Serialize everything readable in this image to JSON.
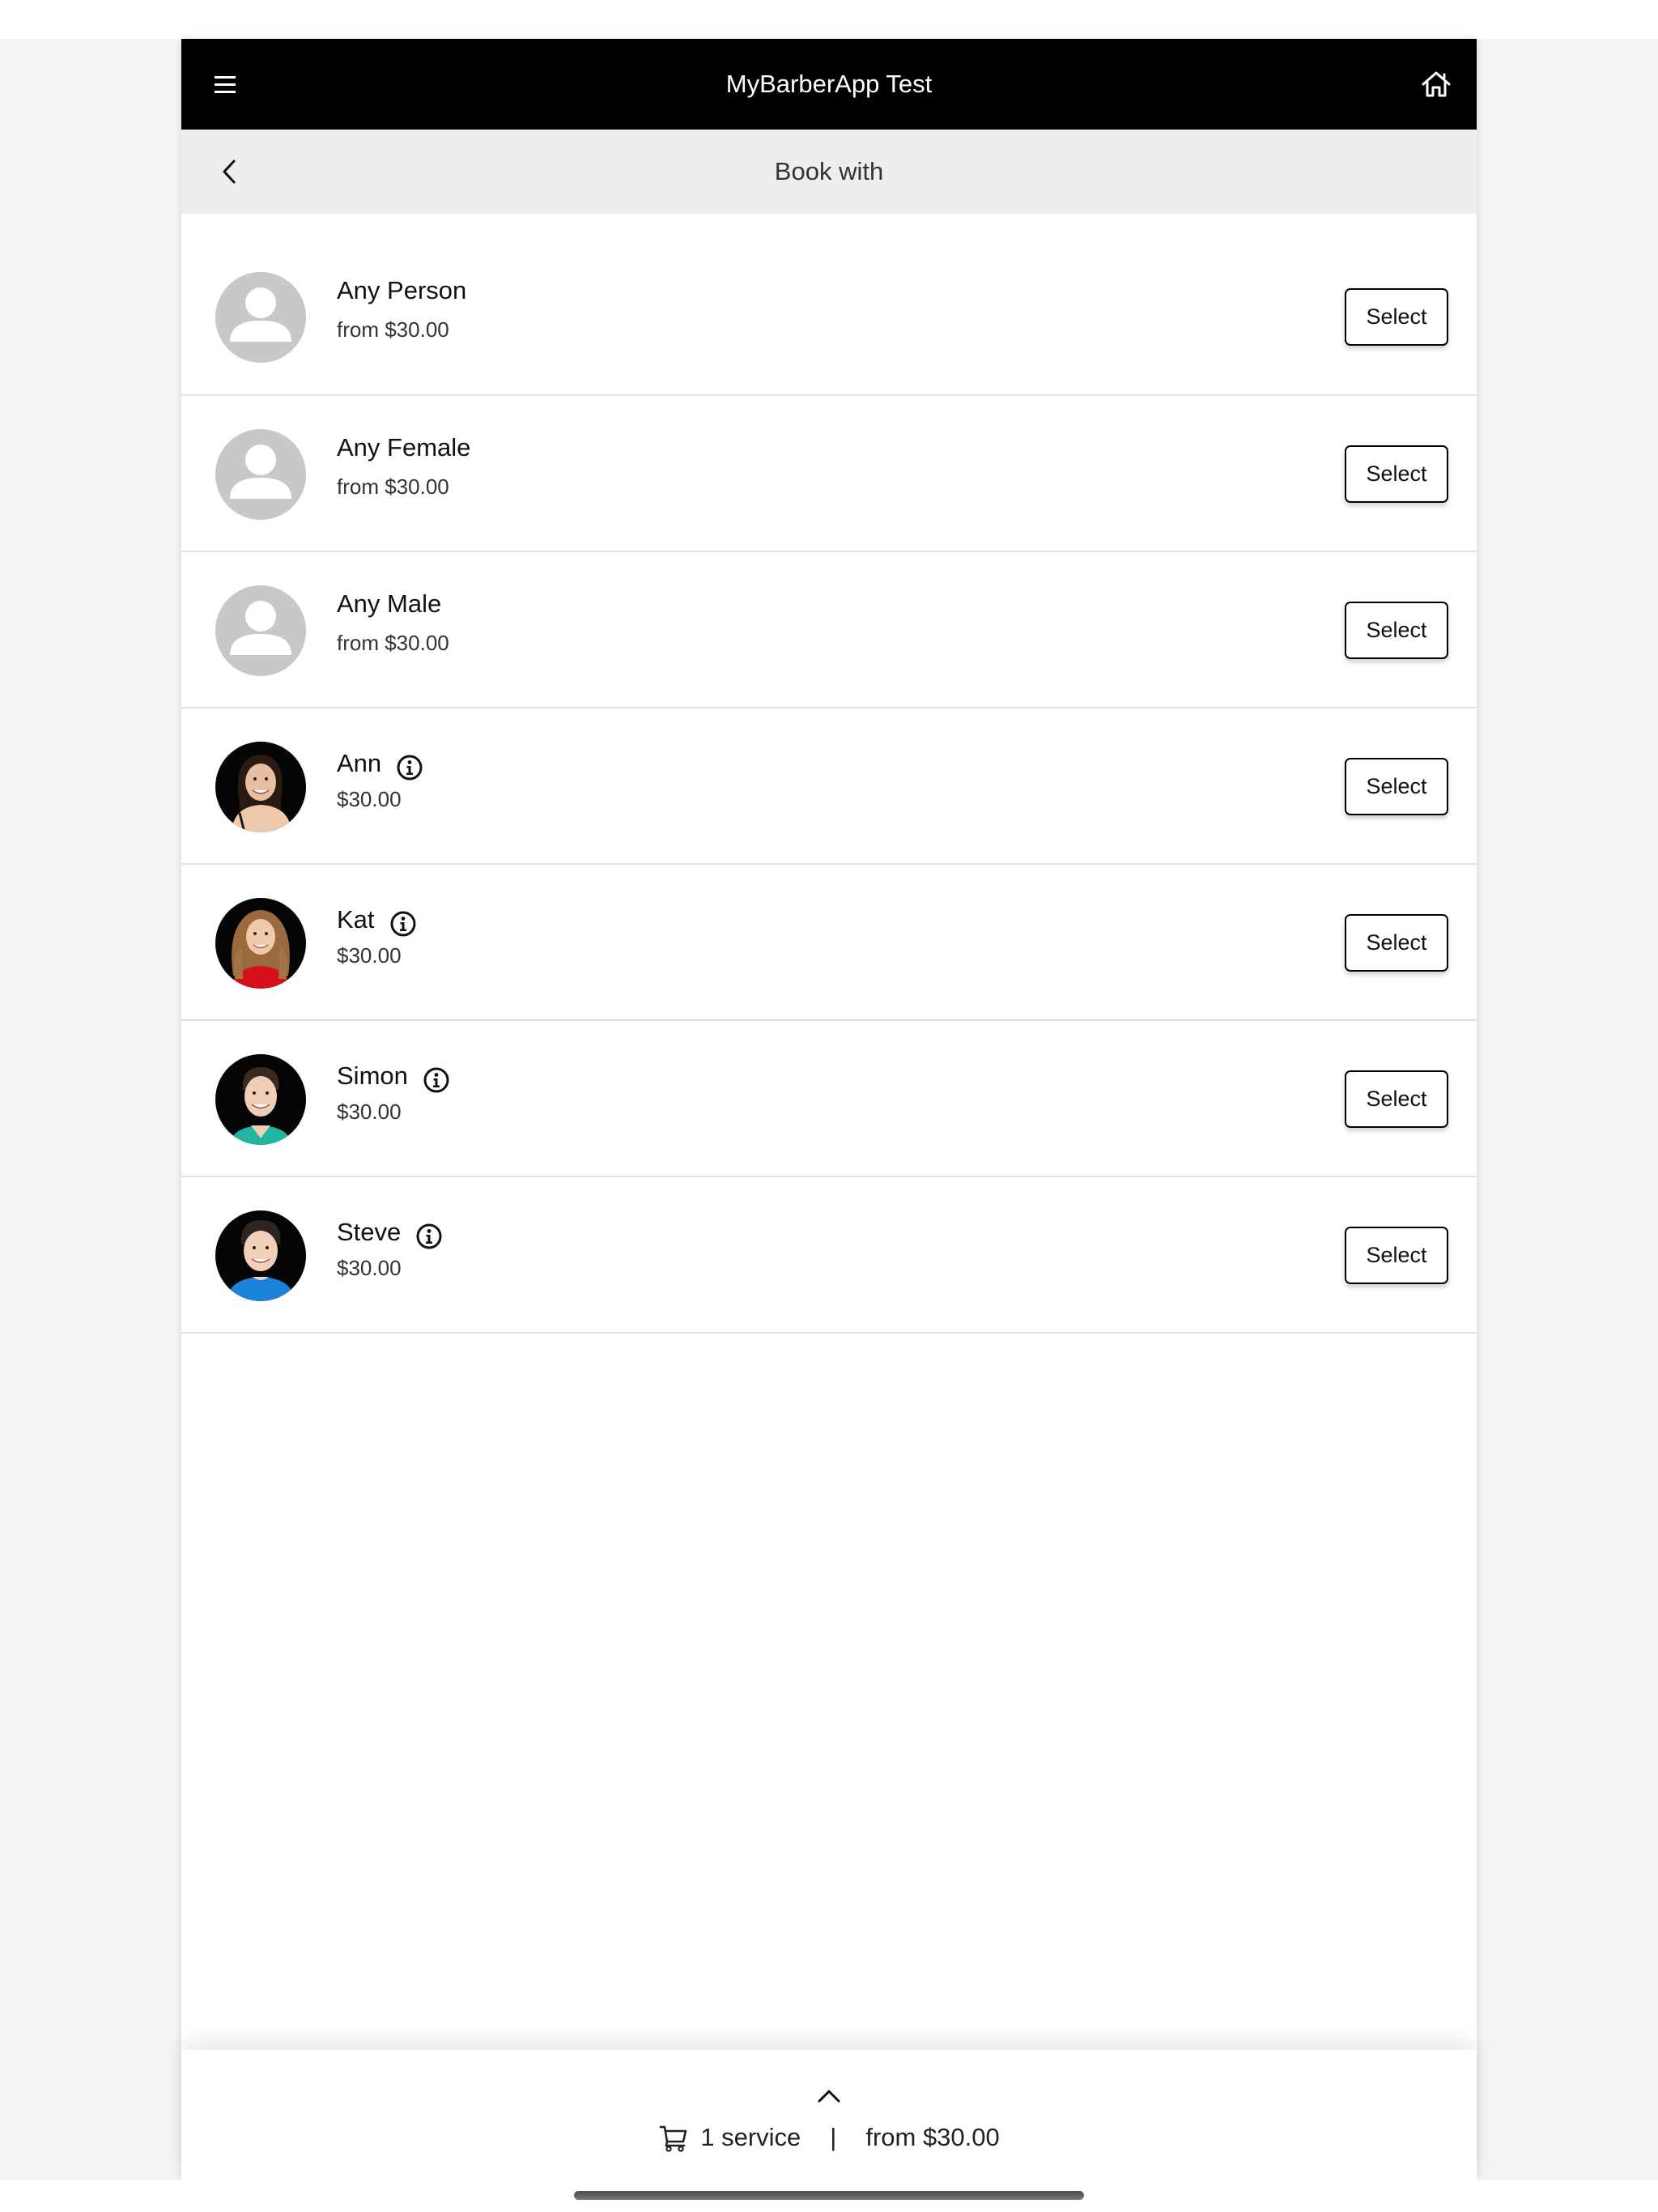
{
  "app": {
    "title": "MyBarberApp Test",
    "menu_icon": "hamburger-menu-icon",
    "home_icon": "home-icon"
  },
  "sub_header": {
    "title": "Book with",
    "back_icon": "chevron-left-icon"
  },
  "staff": [
    {
      "name": "Any Person",
      "price": "from $30.00",
      "avatar": "generic-person-placeholder",
      "has_info": false,
      "select_label": "Select"
    },
    {
      "name": "Any Female",
      "price": "from $30.00",
      "avatar": "generic-person-placeholder",
      "has_info": false,
      "select_label": "Select"
    },
    {
      "name": "Any Male",
      "price": "from $30.00",
      "avatar": "generic-person-placeholder",
      "has_info": false,
      "select_label": "Select"
    },
    {
      "name": "Ann",
      "price": "$30.00",
      "avatar": "photo-woman-dark-hair",
      "has_info": true,
      "select_label": "Select"
    },
    {
      "name": "Kat",
      "price": "$30.00",
      "avatar": "photo-woman-wavy-blond-hair-red-top",
      "has_info": true,
      "select_label": "Select"
    },
    {
      "name": "Simon",
      "price": "$30.00",
      "avatar": "photo-man-dark-hair-teal-top",
      "has_info": true,
      "select_label": "Select"
    },
    {
      "name": "Steve",
      "price": "$30.00",
      "avatar": "photo-man-dark-hair-blue-top",
      "has_info": true,
      "select_label": "Select"
    }
  ],
  "cart": {
    "expand_icon": "chevron-up-icon",
    "icon": "shopping-cart-icon",
    "services": "1 service",
    "separator": "|",
    "total": "from $30.00"
  },
  "colors": {
    "header_bg": "#000000",
    "subheader_bg": "#eeeeee",
    "page_bg": "#f4f4f4",
    "divider": "#e0e2e2",
    "placeholder_avatar": "#c8c8c8"
  }
}
